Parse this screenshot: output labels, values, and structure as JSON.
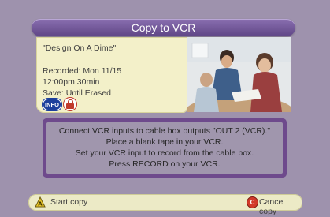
{
  "header": {
    "title": "Copy to VCR"
  },
  "recording": {
    "show_title": "\"Design On A Dime\"",
    "recorded": "Recorded: Mon 11/15",
    "time": "12:00pm  30min",
    "save": "Save: Until Erased",
    "info_badge": "INFO"
  },
  "instructions": {
    "lines": [
      "Connect VCR inputs to cable box outputs \"OUT 2 (VCR).\"",
      "Place a blank tape in your VCR.",
      "Set your VCR input to record from the cable box.",
      "Press RECORD on your VCR."
    ]
  },
  "footer": {
    "start": {
      "key": "A",
      "label": "Start copy"
    },
    "cancel": {
      "key": "C",
      "label": "Cancel copy"
    }
  },
  "colors": {
    "background": "#9e92ad",
    "title_bar": "#6a4f93",
    "card": "#f3f0c9",
    "frame": "#6e4a8c",
    "key_a": "#e8c62a",
    "key_c": "#d23a2a",
    "info_badge": "#1d3f9c"
  },
  "icons": {
    "info": "info-badge-icon",
    "lock": "lock-icon",
    "start": "a-button-icon",
    "cancel": "c-button-icon"
  }
}
